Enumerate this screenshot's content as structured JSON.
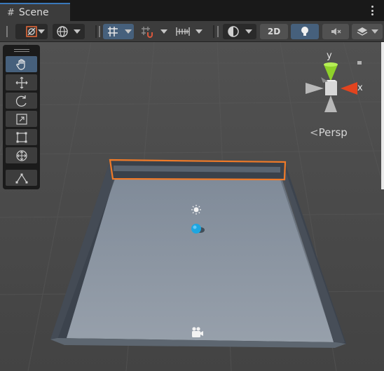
{
  "window": {
    "tab_label": "Scene",
    "tab_icon": "hash-icon"
  },
  "toolbar": {
    "groups": [
      {
        "name": "draw-mode",
        "icon": "shaded-sphere-icon"
      },
      {
        "name": "render-paths",
        "icon": "globe-icon"
      },
      {
        "name": "grid-snap",
        "icon": "grid-icon"
      },
      {
        "name": "increment-snap",
        "icon": "magnet-grid-icon"
      },
      {
        "name": "ruler",
        "icon": "ruler-icon"
      },
      {
        "name": "shading",
        "icon": "sphere-outline-icon"
      },
      {
        "name": "lighting",
        "icon": "lightbulb-icon"
      },
      {
        "name": "audio",
        "icon": "speaker-muted-icon"
      },
      {
        "name": "effects",
        "icon": "layers-icon"
      }
    ],
    "mode_2d_label": "2D"
  },
  "tools": [
    "hand-icon",
    "move-icon",
    "rotate-icon",
    "scale-icon",
    "rect-icon",
    "transform-icon",
    "custom-tool-icon"
  ],
  "gizmo": {
    "y_label": "y",
    "x_label": "x",
    "projection_label": "Persp",
    "colors": {
      "y": "#8fd12a",
      "x": "#e2441f",
      "neutral": "#b8b8b8"
    }
  },
  "scene": {
    "colors": {
      "background": "#474747",
      "floor": "#8a94a0",
      "wall": "#3d4550",
      "selection": "#f07a28",
      "ball": "#1ea6e0"
    }
  }
}
